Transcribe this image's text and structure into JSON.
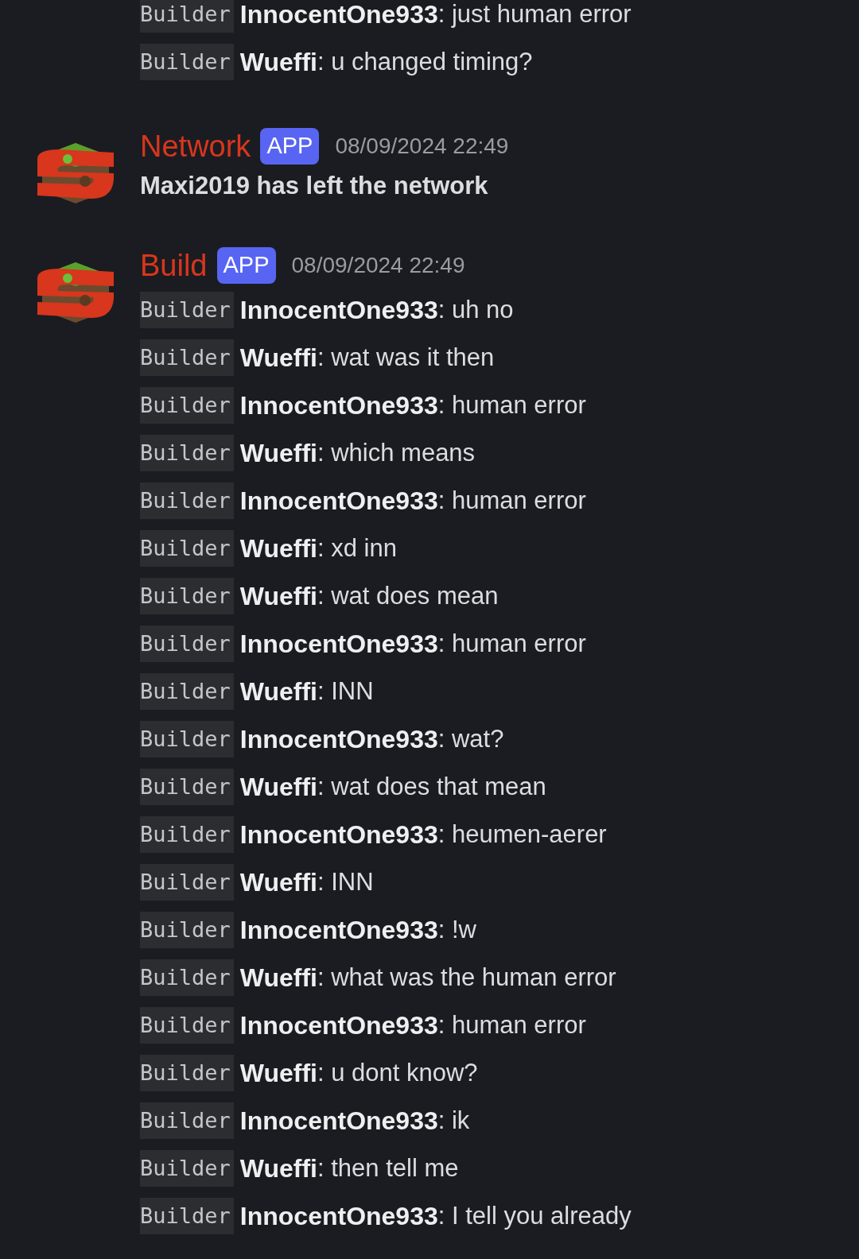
{
  "groups": [
    {
      "continued": true,
      "lines": [
        {
          "rank": "Builder",
          "user": "InnocentOne933",
          "text": ":  just human error"
        },
        {
          "rank": "Builder",
          "user": "Wueffi",
          "text": ":  u changed timing?"
        }
      ]
    },
    {
      "continued": false,
      "author": "Network",
      "badge": "APP",
      "time": "08/09/2024 22:49",
      "system": "Maxi2019 has left the network"
    },
    {
      "continued": false,
      "author": "Build",
      "badge": "APP",
      "time": "08/09/2024 22:49",
      "lines": [
        {
          "rank": "Builder",
          "user": "InnocentOne933",
          "text": ":  uh no"
        },
        {
          "rank": "Builder",
          "user": "Wueffi",
          "text": ":  wat was it then"
        },
        {
          "rank": "Builder",
          "user": "InnocentOne933",
          "text": ":  human error"
        },
        {
          "rank": "Builder",
          "user": "Wueffi",
          "text": ":  which means"
        },
        {
          "rank": "Builder",
          "user": "InnocentOne933",
          "text": ":  human error"
        },
        {
          "rank": "Builder",
          "user": "Wueffi",
          "text": ":  xd inn"
        },
        {
          "rank": "Builder",
          "user": "Wueffi",
          "text": ":  wat does mean"
        },
        {
          "rank": "Builder",
          "user": "InnocentOne933",
          "text": ":  human error"
        },
        {
          "rank": "Builder",
          "user": "Wueffi",
          "text": ":  INN"
        },
        {
          "rank": "Builder",
          "user": "InnocentOne933",
          "text": ":  wat?"
        },
        {
          "rank": "Builder",
          "user": "Wueffi",
          "text": ":  wat does that mean"
        },
        {
          "rank": "Builder",
          "user": "InnocentOne933",
          "text": ":  heumen-aerer"
        },
        {
          "rank": "Builder",
          "user": "Wueffi",
          "text": ":  INN"
        },
        {
          "rank": "Builder",
          "user": "InnocentOne933",
          "text": ":  !w"
        },
        {
          "rank": "Builder",
          "user": "Wueffi",
          "text": ":  what was the human error"
        },
        {
          "rank": "Builder",
          "user": "InnocentOne933",
          "text": ":  human error"
        },
        {
          "rank": "Builder",
          "user": "Wueffi",
          "text": ":  u dont know?"
        },
        {
          "rank": "Builder",
          "user": "InnocentOne933",
          "text": ":  ik"
        },
        {
          "rank": "Builder",
          "user": "Wueffi",
          "text": ":  then tell me"
        },
        {
          "rank": "Builder",
          "user": "InnocentOne933",
          "text": ":  I tell you already"
        }
      ]
    }
  ]
}
